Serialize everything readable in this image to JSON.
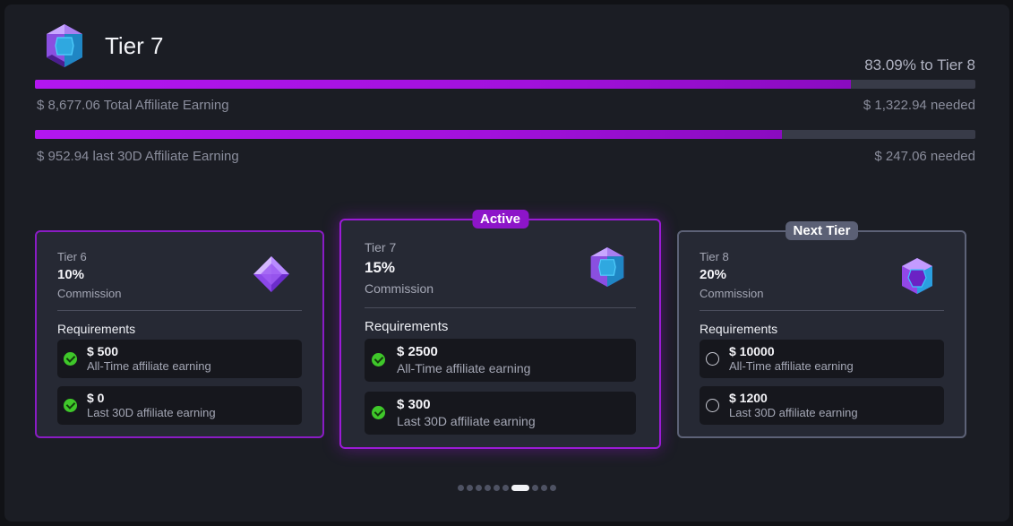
{
  "header": {
    "current_tier": "Tier 7",
    "gem_icon": "hexagon-gem-icon",
    "progress_text": "83.09% to Tier 8"
  },
  "progress": {
    "total": {
      "fraction": 0.8677,
      "label": "$ 8,677.06 Total Affiliate Earning",
      "needed": "$ 1,322.94 needed"
    },
    "last30": {
      "fraction": 0.7941,
      "label": "$ 952.94 last 30D Affiliate Earning",
      "needed": "$ 247.06 needed"
    }
  },
  "colors": {
    "accent": "#9b1bd6",
    "bar_track": "#383b48",
    "check": "#3fc82a",
    "panel": "#1b1d24",
    "card": "#262934"
  },
  "cards": [
    {
      "tier": "Tier 6",
      "percent": "10%",
      "commission": "Commission",
      "icon": "diamond-gem-icon",
      "badge": "",
      "requirements_title": "Requirements",
      "requirements": [
        {
          "amount": "$ 500",
          "desc": "All-Time affiliate earning",
          "met": true
        },
        {
          "amount": "$ 0",
          "desc": "Last 30D affiliate earning",
          "met": true
        }
      ]
    },
    {
      "tier": "Tier 7",
      "percent": "15%",
      "commission": "Commission",
      "icon": "hexagon-gem-icon",
      "badge": "Active",
      "requirements_title": "Requirements",
      "requirements": [
        {
          "amount": "$ 2500",
          "desc": "All-Time affiliate earning",
          "met": true
        },
        {
          "amount": "$ 300",
          "desc": "Last 30D affiliate earning",
          "met": true
        }
      ]
    },
    {
      "tier": "Tier 8",
      "percent": "20%",
      "commission": "Commission",
      "icon": "cube-gem-icon",
      "badge": "Next Tier",
      "requirements_title": "Requirements",
      "requirements": [
        {
          "amount": "$ 10000",
          "desc": "All-Time affiliate earning",
          "met": false
        },
        {
          "amount": "$ 1200",
          "desc": "Last 30D affiliate earning",
          "met": false
        }
      ]
    }
  ],
  "pagination": {
    "count": 10,
    "active": 6
  }
}
